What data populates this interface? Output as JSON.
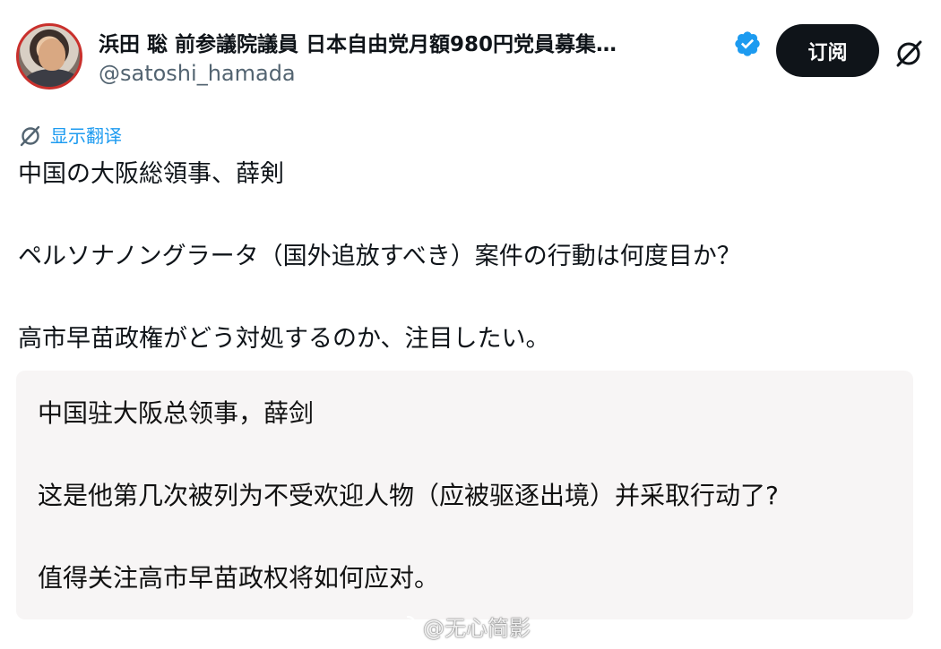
{
  "author": {
    "display_name": "浜田 聡 前参議院議員 日本自由党月額980円党員募集…",
    "handle": "@satoshi_hamada",
    "verified_icon": "verified-badge-icon",
    "avatar": "profile-photo"
  },
  "actions": {
    "subscribe_label": "订阅",
    "grok_icon": "slashed-circle-icon"
  },
  "translate": {
    "label": "显示翻译",
    "icon": "slashed-circle-icon"
  },
  "tweet": {
    "lines": [
      "中国の大阪総領事、薛剣",
      "ペルソナノングラータ（国外追放すべき）案件の行動は何度目か？",
      "高市早苗政権がどう対処するのか、注目したい。"
    ]
  },
  "translation": {
    "lines": [
      "中国驻大阪总领事，薛剑",
      "这是他第几次被列为不受欢迎人物（应被驱逐出境）并采取行动了?",
      "值得关注高市早苗政权将如何应对。"
    ]
  },
  "watermark": {
    "text": "@无心简影",
    "icon": "weibo-icon"
  },
  "colors": {
    "link": "#1d9bf0",
    "verified": "#1d9bf0",
    "button_bg": "#0f1419",
    "secondary_text": "#536471",
    "translation_bg": "#f7f5f5"
  }
}
